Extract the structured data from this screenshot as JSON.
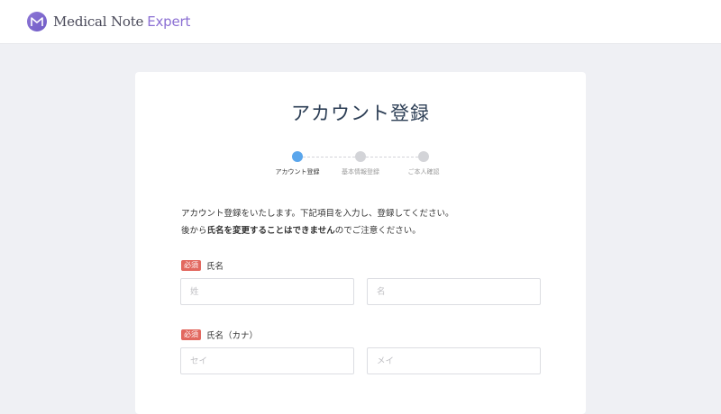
{
  "header": {
    "logo_icon": "medical-note-logo-icon",
    "logo_text_primary": "Medical Note",
    "logo_text_accent": "Expert",
    "accent_color": "#8b6fd3"
  },
  "page": {
    "title": "アカウント登録"
  },
  "steps": [
    {
      "label": "アカウント登録",
      "active": true
    },
    {
      "label": "基本情報登録",
      "active": false
    },
    {
      "label": "ご本人確認",
      "active": false
    }
  ],
  "intro": {
    "line1": "アカウント登録をいたします。下記項目を入力し、登録してください。",
    "line2_pre": "後から",
    "line2_bold": "氏名を変更することはできません",
    "line2_post": "のでご注意ください。"
  },
  "form": {
    "required_badge": "必須",
    "name": {
      "label": "氏名",
      "last_placeholder": "姓",
      "last_value": "",
      "first_placeholder": "名",
      "first_value": ""
    },
    "kana": {
      "label": "氏名（カナ）",
      "last_placeholder": "セイ",
      "last_value": "",
      "first_placeholder": "メイ",
      "first_value": ""
    }
  },
  "colors": {
    "step_active": "#5aa6ec",
    "step_inactive": "#d3d4d8",
    "required_badge": "#e2685f",
    "title": "#2c3e55"
  }
}
